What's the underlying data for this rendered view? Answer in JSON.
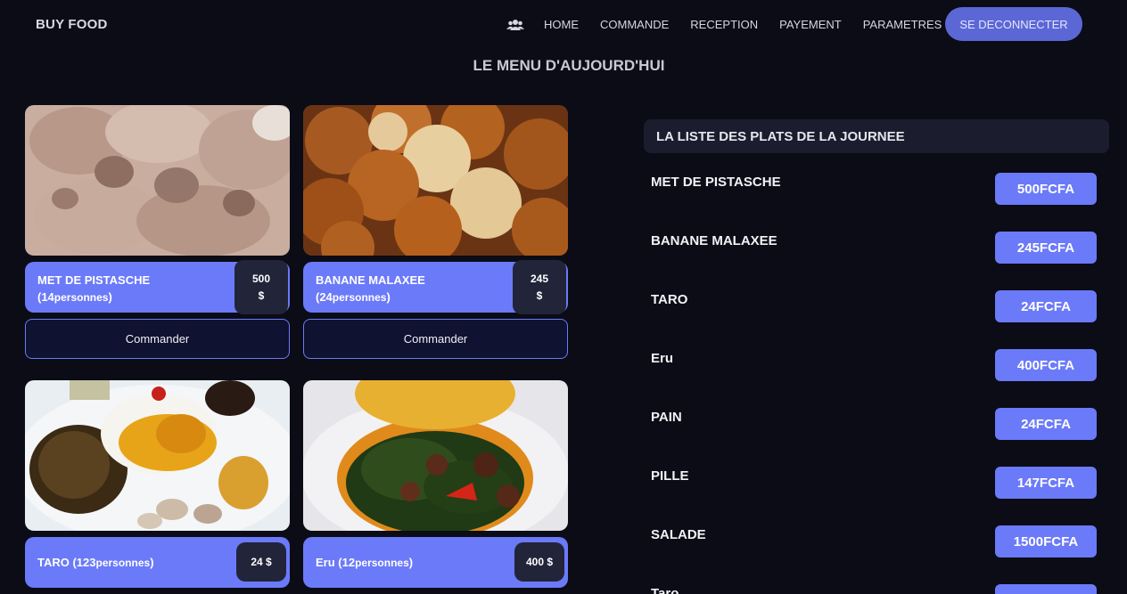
{
  "nav": {
    "brand": "BUY FOOD",
    "icon": "users-icon",
    "links": [
      "HOME",
      "COMMANDE",
      "RECEPTION",
      "PAYEMENT",
      "PARAMETRES"
    ],
    "logout": "SE DECONNECTER"
  },
  "page_title": "LE MENU D'AUJOURD'HUI",
  "cards": [
    {
      "name": "MET DE PISTASCHE",
      "persons_open": "(14",
      "persons_word": "personnes",
      "persons_close": ")",
      "price": "500",
      "currency": "$",
      "order": "Commander"
    },
    {
      "name": "BANANE MALAXEE",
      "persons_open": "(24",
      "persons_word": "personnes",
      "persons_close": ")",
      "price": "245",
      "currency": "$",
      "order": "Commander"
    },
    {
      "name": "TARO (123",
      "persons_word": "personnes",
      "persons_close": ")",
      "price": "24 $"
    },
    {
      "name": "Eru (12",
      "persons_word": "personnes",
      "persons_close": ")",
      "price": "400 $"
    }
  ],
  "list": {
    "title": "LA LISTE DES PLATS DE LA JOURNEE",
    "items": [
      {
        "name": "MET DE PISTASCHE",
        "price": "500FCFA"
      },
      {
        "name": "BANANE MALAXEE",
        "price": "245FCFA"
      },
      {
        "name": "TARO",
        "price": "24FCFA"
      },
      {
        "name": "Eru",
        "price": "400FCFA"
      },
      {
        "name": "PAIN",
        "price": "24FCFA"
      },
      {
        "name": "PILLE",
        "price": "147FCFA"
      },
      {
        "name": "SALADE",
        "price": "1500FCFA"
      },
      {
        "name": "Taro",
        "price": ""
      }
    ]
  },
  "colors": {
    "background": "#0b0c16",
    "accent": "#6b7af8",
    "button": "#5c67d6",
    "price_box": "#22243a"
  }
}
